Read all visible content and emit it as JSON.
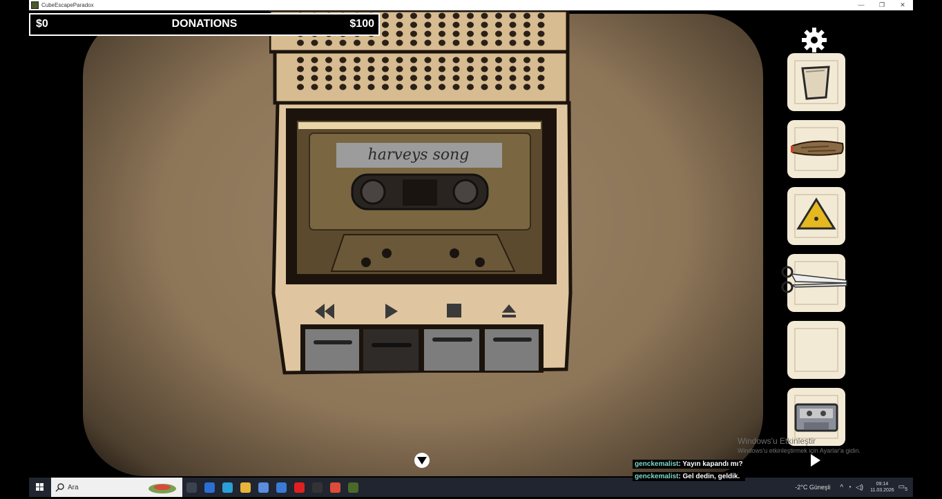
{
  "window": {
    "title": "CubeEscapeParadox",
    "controls": [
      "—",
      "❐",
      "✕"
    ]
  },
  "donations": {
    "min": "$0",
    "label": "DONATIONS",
    "max": "$100",
    "progress_fraction": 0
  },
  "cassette": {
    "label": "harveys song",
    "buttons": [
      "rewind",
      "play",
      "stop",
      "eject"
    ]
  },
  "inventory": {
    "items": [
      {
        "name": "glass",
        "icon": "glass-icon"
      },
      {
        "name": "cigar",
        "icon": "cigar-icon"
      },
      {
        "name": "triangle",
        "icon": "yellow-triangle-icon"
      },
      {
        "name": "scissors",
        "icon": "scissors-icon"
      },
      {
        "name": "empty",
        "icon": ""
      },
      {
        "name": "cassette",
        "icon": "cassette-icon"
      }
    ]
  },
  "watermark": {
    "title": "Windows'u Etkinleştir",
    "subtitle": "Windows'u etkinleştirmek için Ayarlar'a gidin."
  },
  "chat": [
    {
      "user": "genckemalist",
      "message": ": Yayın kapandı mı?"
    },
    {
      "user": "genckemalist",
      "message": ": Gel dedin, geldik."
    }
  ],
  "taskbar": {
    "search_placeholder": "Ara",
    "weather": "-2°C  Güneşli",
    "time": "09:14",
    "date": "11.03.2026",
    "notification_count": "5",
    "apps": [
      {
        "icon": "task-view-icon",
        "color": "#3c4250"
      },
      {
        "icon": "app-blue-icon",
        "color": "#2b6fd6"
      },
      {
        "icon": "edge-icon",
        "color": "#2a9fd8"
      },
      {
        "icon": "file-explorer-icon",
        "color": "#e8b43a"
      },
      {
        "icon": "store-icon",
        "color": "#5a8de0"
      },
      {
        "icon": "mail-icon",
        "color": "#3a7bd5"
      },
      {
        "icon": "youtube-icon",
        "color": "#e02020"
      },
      {
        "icon": "steam-icon",
        "color": "#333333"
      },
      {
        "icon": "chrome-icon",
        "color": "#dd4b39"
      },
      {
        "icon": "game-icon",
        "color": "#4a6a2a"
      }
    ]
  }
}
